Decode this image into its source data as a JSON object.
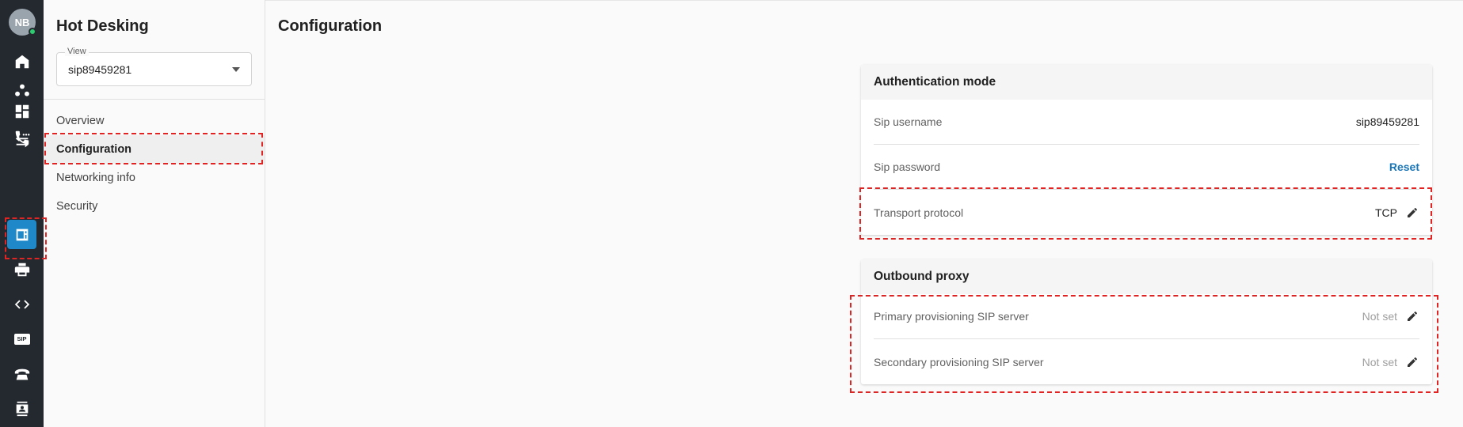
{
  "rail": {
    "avatar_initials": "NB",
    "icons": [
      "home-icon",
      "users-icon",
      "dashboard-icon",
      "transfer-icon",
      "phone-dots-icon",
      "hot-desking-icon",
      "printer-icon",
      "code-icon",
      "sip-icon",
      "telephone-icon",
      "contacts-icon"
    ],
    "active_icon": "hot-desking-icon",
    "sip_glyph": "SIP",
    "accent": "#1e88c8"
  },
  "sidebar": {
    "title": "Hot Desking",
    "view_label": "View",
    "view_value": "sip89459281",
    "items": [
      {
        "label": "Overview"
      },
      {
        "label": "Configuration"
      },
      {
        "label": "Networking info"
      },
      {
        "label": "Security"
      }
    ],
    "active_item": "Configuration"
  },
  "main": {
    "title": "Configuration",
    "auth_card": {
      "title": "Authentication mode",
      "rows": [
        {
          "label": "Sip username",
          "value": "sip89459281"
        },
        {
          "label": "Sip password",
          "action": "Reset"
        },
        {
          "label": "Transport protocol",
          "value": "TCP"
        }
      ]
    },
    "proxy_card": {
      "title": "Outbound proxy",
      "rows": [
        {
          "label": "Primary provisioning SIP server",
          "value": "Not set"
        },
        {
          "label": "Secondary provisioning SIP server",
          "value": "Not set"
        }
      ]
    }
  },
  "colors": {
    "link": "#1976b8",
    "highlight": "#e02424",
    "online": "#2ecc71"
  }
}
